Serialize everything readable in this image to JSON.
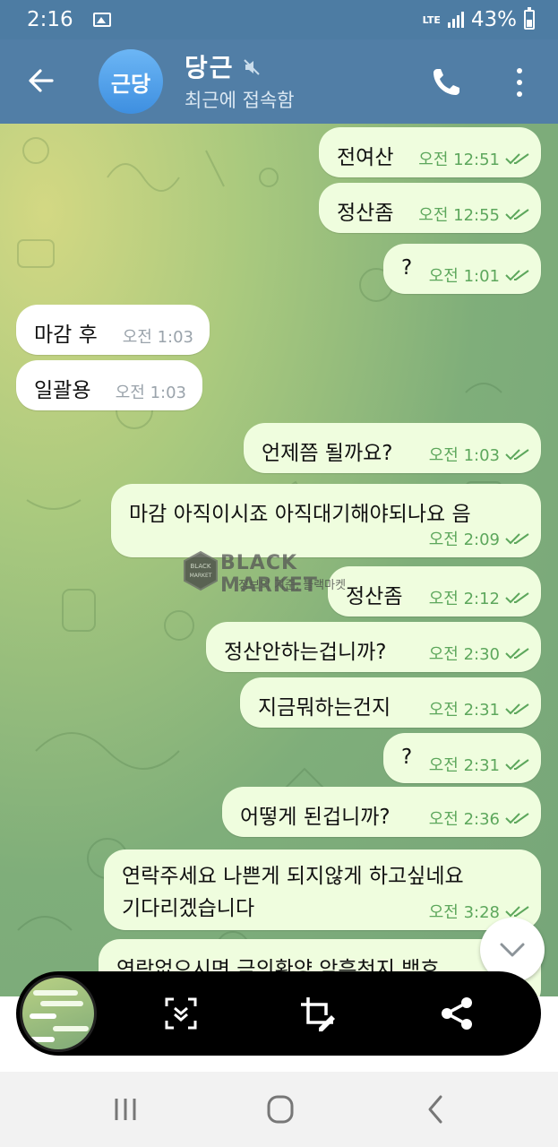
{
  "status_bar": {
    "time": "2:16",
    "network": "LTE",
    "battery": "43%"
  },
  "header": {
    "avatar_text": "근당",
    "name": "당근",
    "status": "최근에 접속함",
    "colors": {
      "header_bg": "#517ea6",
      "avatar": "#4a9be8"
    }
  },
  "messages": [
    {
      "side": "out",
      "text": "전여산",
      "time": "오전 12:51"
    },
    {
      "side": "out",
      "text": "정산좀",
      "time": "오전 12:55"
    },
    {
      "side": "out",
      "text": "?",
      "time": "오전 1:01"
    },
    {
      "side": "in",
      "text": "마감 후",
      "time": "오전 1:03"
    },
    {
      "side": "in",
      "text": "일괄용",
      "time": "오전 1:03"
    },
    {
      "side": "out",
      "text": "언제쯤 될까요?",
      "time": "오전 1:03"
    },
    {
      "side": "out",
      "text": "마감 아직이시죠 아직대기해야되나요 음",
      "time": "오전 2:09"
    },
    {
      "side": "out",
      "text": "정산좀",
      "time": "오전 2:12"
    },
    {
      "side": "out",
      "text": "정산안하는겁니까?",
      "time": "오전 2:30"
    },
    {
      "side": "out",
      "text": "지금뭐하는건지",
      "time": "오전 2:31"
    },
    {
      "side": "out",
      "text": "?",
      "time": "오전 2:31"
    },
    {
      "side": "out",
      "text": "어떻게 된겁니까?",
      "time": "오전 2:36"
    },
    {
      "side": "out",
      "text": "연락주세요 나쁜게 되지않게 하고싶네요",
      "text2": "기다리겠습니다",
      "time": "오전 3:28"
    },
    {
      "side": "out",
      "text": "연락없으시면 금의환양 암흑천지 백호"
    }
  ],
  "watermark": {
    "badge": "BLACK MARKET",
    "title": "BLACK MARKET",
    "subtitle": "정보의 기준, 블랙마켓"
  },
  "icons": {
    "back": "arrow-left-icon",
    "mute": "muted-speaker-icon",
    "call": "phone-icon",
    "more": "kebab-menu-icon",
    "scroll_down": "chevron-down-icon",
    "scan": "scroll-capture-icon",
    "edit": "crop-edit-icon",
    "share": "share-icon"
  }
}
